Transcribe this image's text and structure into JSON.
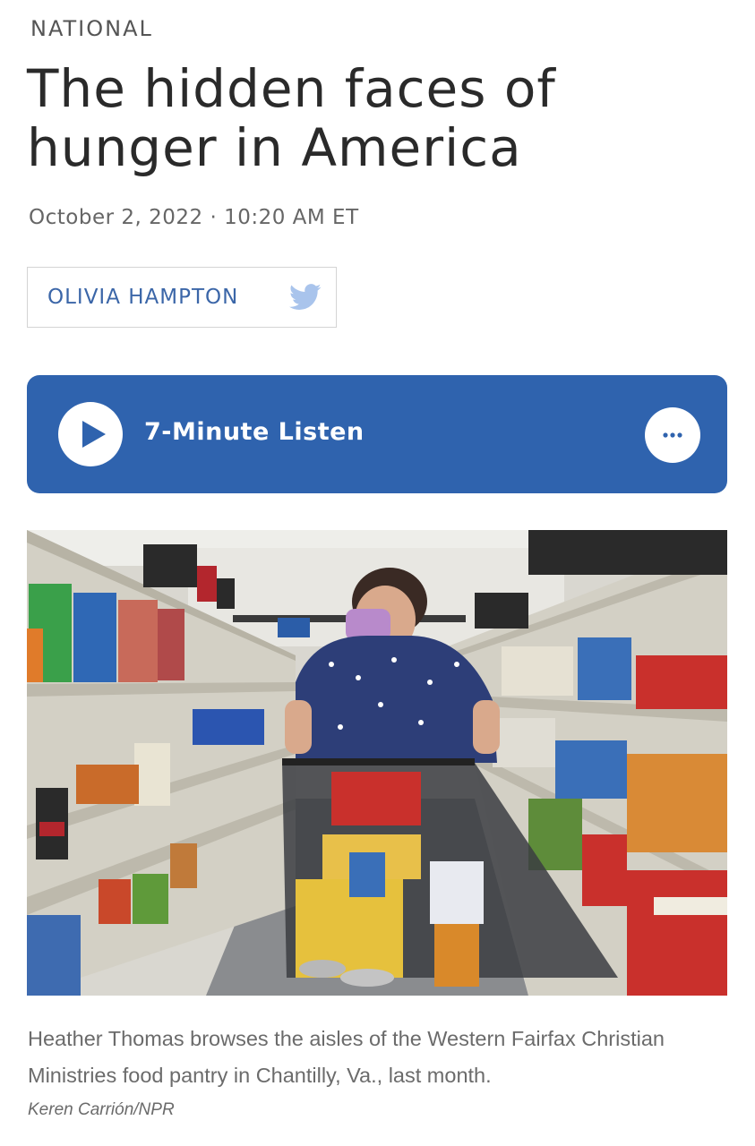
{
  "section": "NATIONAL",
  "headline": "The hidden faces of hunger in America",
  "dateline": "October 2, 2022 · 10:20 AM ET",
  "byline": {
    "author": "OLIVIA HAMPTON",
    "icon": "twitter-icon"
  },
  "audio": {
    "label": "7-Minute Listen",
    "play_icon": "play-icon",
    "more_icon": "more-options-icon",
    "accent": "#2f63ae"
  },
  "photo": {
    "caption": "Heather Thomas browses the aisles of the Western Fairfax Christian Ministries food pantry in Chantilly, Va., last month.",
    "credit": "Keren Carrión/NPR"
  },
  "colors": {
    "link": "#3b66a8",
    "twitter": "#a9c4ec"
  }
}
